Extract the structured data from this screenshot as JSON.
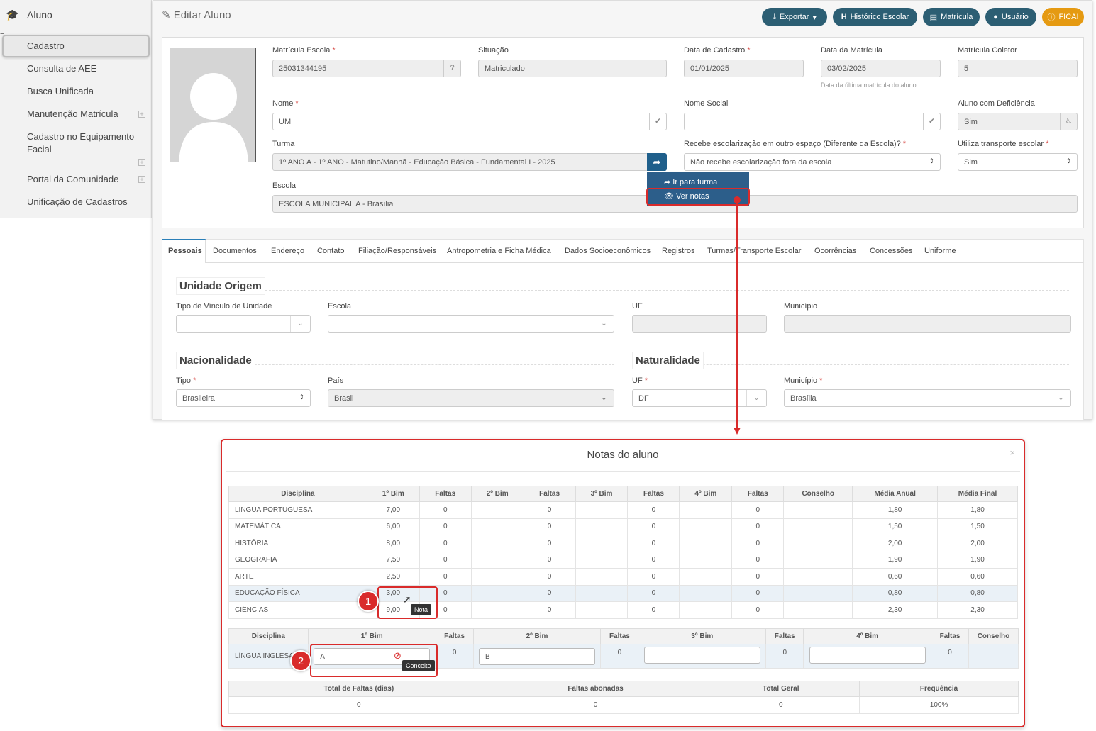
{
  "sidebar": {
    "title": "Aluno",
    "items": [
      {
        "label": "Cadastro"
      },
      {
        "label": "Consulta de AEE"
      },
      {
        "label": "Busca Unificada"
      },
      {
        "label": "Manutenção Matrícula"
      },
      {
        "label": "Cadastro no Equipamento"
      },
      {
        "label": "Facial"
      },
      {
        "label": "Portal da Comunidade"
      },
      {
        "label": "Unificação de Cadastros"
      }
    ]
  },
  "header": {
    "title": "Editar Aluno",
    "buttons": {
      "exportar": "Exportar",
      "historico": "Histórico Escolar",
      "matricula": "Matrícula",
      "usuario": "Usuário",
      "ficai": "FICAI"
    }
  },
  "form": {
    "matricula_escola": {
      "label": "Matrícula Escola",
      "value": "25031344195"
    },
    "situacao": {
      "label": "Situação",
      "value": "Matriculado"
    },
    "data_cadastro": {
      "label": "Data de Cadastro",
      "value": "01/01/2025"
    },
    "data_matricula": {
      "label": "Data da Matrícula",
      "value": "03/02/2025",
      "hint": "Data da última matrícula do aluno."
    },
    "matricula_coletor": {
      "label": "Matrícula Coletor",
      "value": "5"
    },
    "nome": {
      "label": "Nome",
      "value": "UM"
    },
    "nome_social": {
      "label": "Nome Social",
      "value": ""
    },
    "deficiencia": {
      "label": "Aluno com Deficiência",
      "value": "Sim"
    },
    "turma": {
      "label": "Turma",
      "value": "1º ANO A - 1º ANO - Matutino/Manhã - Educação Básica - Fundamental I - 2025"
    },
    "outro_espaco": {
      "label": "Recebe escolarização em outro espaço (Diferente da Escola)?",
      "value": "Não recebe escolarização fora da escola"
    },
    "transporte": {
      "label": "Utiliza transporte escolar",
      "value": "Sim"
    },
    "escola": {
      "label": "Escola",
      "value": "ESCOLA MUNICIPAL A - Brasília"
    }
  },
  "turma_menu": {
    "ir": "Ir para turma",
    "ver": "Ver notas"
  },
  "tabs": [
    "Pessoais",
    "Documentos",
    "Endereço",
    "Contato",
    "Filiação/Responsáveis",
    "Antropometria e Ficha Médica",
    "Dados Socioeconômicos",
    "Registros",
    "Turmas/Transporte Escolar",
    "Ocorrências",
    "Concessões",
    "Uniforme"
  ],
  "pessoais": {
    "unidade_origem": "Unidade Origem",
    "tipo_vinculo": "Tipo de Vínculo de Unidade",
    "escola": "Escola",
    "uf": "UF",
    "municipio": "Município",
    "nacionalidade": "Nacionalidade",
    "naturalidade": "Naturalidade",
    "tipo": {
      "label": "Tipo",
      "value": "Brasileira"
    },
    "pais": {
      "label": "País",
      "value": "Brasil"
    },
    "nat_uf": {
      "label": "UF",
      "value": "DF"
    },
    "nat_municipio": {
      "label": "Município",
      "value": "Brasília"
    }
  },
  "modal": {
    "title": "Notas do aluno",
    "close": "×",
    "grades_headers": [
      "Disciplina",
      "1º Bim",
      "Faltas",
      "2º Bim",
      "Faltas",
      "3º Bim",
      "Faltas",
      "4º Bim",
      "Faltas",
      "Conselho",
      "Média Anual",
      "Média Final"
    ],
    "grades": [
      [
        "LINGUA PORTUGUESA",
        "7,00",
        "0",
        "",
        "0",
        "",
        "0",
        "",
        "0",
        "",
        "1,80",
        "1,80"
      ],
      [
        "MATEMÁTICA",
        "6,00",
        "0",
        "",
        "0",
        "",
        "0",
        "",
        "0",
        "",
        "1,50",
        "1,50"
      ],
      [
        "HISTÓRIA",
        "8,00",
        "0",
        "",
        "0",
        "",
        "0",
        "",
        "0",
        "",
        "2,00",
        "2,00"
      ],
      [
        "GEOGRAFIA",
        "7,50",
        "0",
        "",
        "0",
        "",
        "0",
        "",
        "0",
        "",
        "1,90",
        "1,90"
      ],
      [
        "ARTE",
        "2,50",
        "0",
        "",
        "0",
        "",
        "0",
        "",
        "0",
        "",
        "0,60",
        "0,60"
      ],
      [
        "EDUCAÇÃO FÍSICA",
        "3,00",
        "0",
        "",
        "0",
        "",
        "0",
        "",
        "0",
        "",
        "0,80",
        "0,80"
      ],
      [
        "CIÊNCIAS",
        "9,00",
        "0",
        "",
        "0",
        "",
        "0",
        "",
        "0",
        "",
        "2,30",
        "2,30"
      ]
    ],
    "concept_headers": [
      "Disciplina",
      "1º Bim",
      "Faltas",
      "2º Bim",
      "Faltas",
      "3º Bim",
      "Faltas",
      "4º Bim",
      "Faltas",
      "Conselho"
    ],
    "concept_row": {
      "disciplina": "LÍNGUA INGLESA",
      "b1": "A",
      "f1": "0",
      "b2": "B",
      "f2": "0",
      "b3": "",
      "f3": "0",
      "b4": "",
      "f4": "0"
    },
    "totals_headers": [
      "Total de Faltas (dias)",
      "Faltas abonadas",
      "Total Geral",
      "Frequência"
    ],
    "totals": [
      "0",
      "0",
      "0",
      "100%"
    ],
    "tooltip_nota": "Nota",
    "tooltip_conceito": "Conceito",
    "badge1": "1",
    "badge2": "2"
  }
}
